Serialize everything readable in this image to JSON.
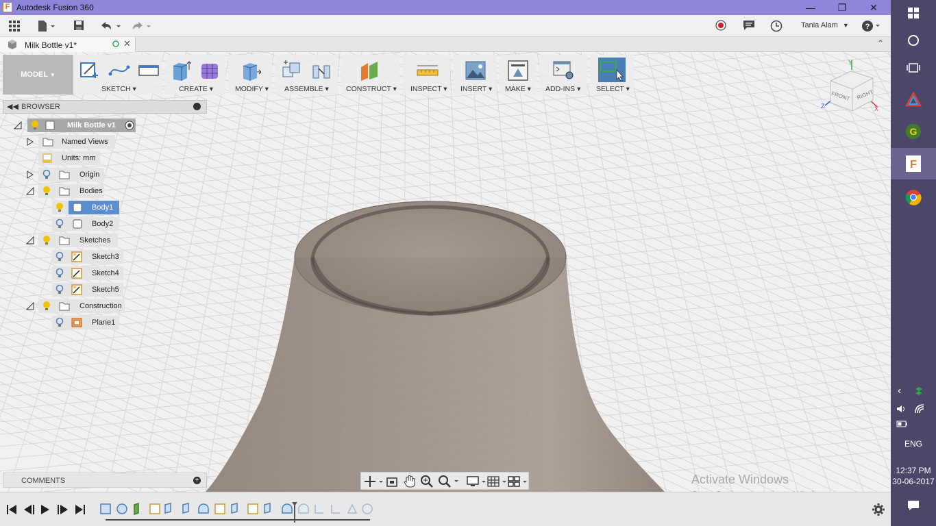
{
  "window": {
    "title": "Autodesk Fusion 360",
    "logo_letter": "F"
  },
  "quick_access": {
    "user_name": "Tania Alam"
  },
  "document_tab": {
    "name": "Milk Bottle v1*"
  },
  "toolbar": {
    "workspace": "MODEL",
    "groups": [
      {
        "label": "SKETCH"
      },
      {
        "label": "CREATE"
      },
      {
        "label": "MODIFY"
      },
      {
        "label": "ASSEMBLE"
      },
      {
        "label": "CONSTRUCT"
      },
      {
        "label": "INSPECT"
      },
      {
        "label": "INSERT"
      },
      {
        "label": "MAKE"
      },
      {
        "label": "ADD-INS"
      },
      {
        "label": "SELECT"
      }
    ]
  },
  "viewcube": {
    "front": "FRONT",
    "right": "RIGHT",
    "axis_x": "X",
    "axis_y": "Y",
    "axis_z": "Z"
  },
  "browser": {
    "title": "BROWSER",
    "root": "Milk Bottle v1",
    "items": [
      {
        "label": "Named Views"
      },
      {
        "label": "Units: mm"
      },
      {
        "label": "Origin"
      },
      {
        "label": "Bodies"
      },
      {
        "label": "Body1"
      },
      {
        "label": "Body2"
      },
      {
        "label": "Sketches"
      },
      {
        "label": "Sketch3"
      },
      {
        "label": "Sketch4"
      },
      {
        "label": "Sketch5"
      },
      {
        "label": "Construction"
      },
      {
        "label": "Plane1"
      }
    ]
  },
  "comments": {
    "title": "COMMENTS"
  },
  "watermark": {
    "line1": "Activate Windows",
    "line2": "Go to Settings to activate Windows."
  },
  "taskbar": {
    "language": "ENG",
    "time": "12:37 PM",
    "date": "30-06-2017"
  },
  "colors": {
    "titlebar": "#8e86d8",
    "taskbar": "#4c4669",
    "select_active": "#4a7fb5",
    "bulb": "#f2c200"
  }
}
